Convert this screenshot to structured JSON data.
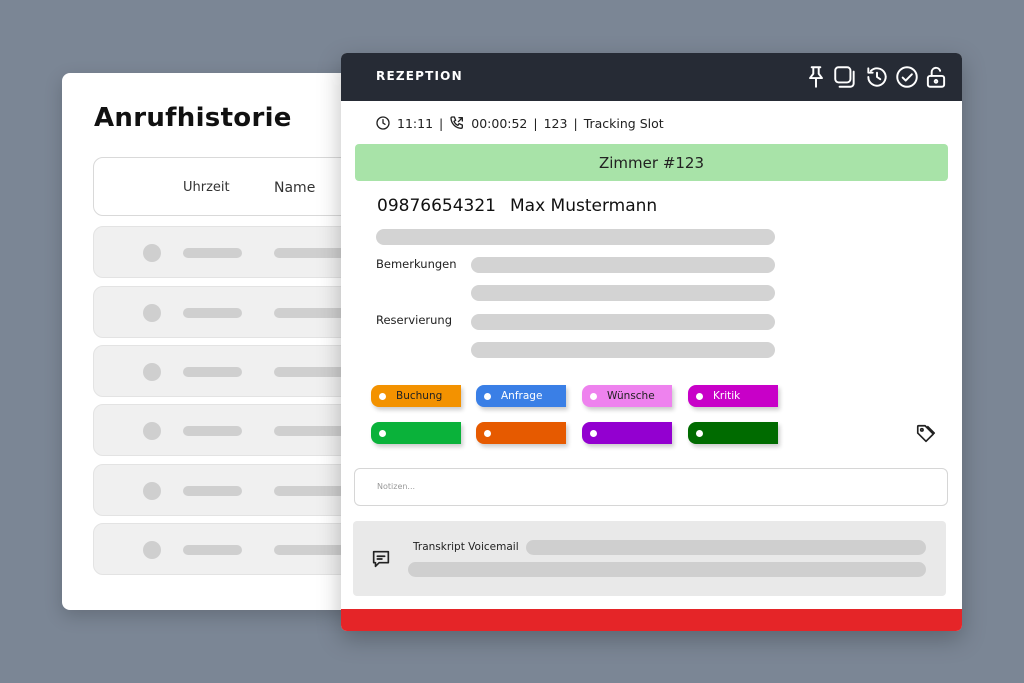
{
  "history": {
    "title": "Anrufhistorie",
    "columns": {
      "time": "Uhrzeit",
      "name": "Name"
    },
    "row_count": 6
  },
  "reception": {
    "title": "REZEPTION",
    "toolbar_icons": [
      "pin-icon",
      "copy-icon",
      "history-icon",
      "check-circle-icon",
      "unlock-icon"
    ],
    "info": {
      "time": "11:11",
      "duration": "00:00:52",
      "extension": "123",
      "slot": "Tracking Slot"
    },
    "room": "Zimmer #123",
    "caller": {
      "phone": "09876654321",
      "name": "Max Mustermann"
    },
    "labels": {
      "remarks": "Bemerkungen",
      "reservation": "Reservierung"
    },
    "tags_labeled": [
      {
        "label": "Buchung",
        "color": "#f39200"
      },
      {
        "label": "Anfrage",
        "color": "#3a7fe6"
      },
      {
        "label": "Wünsche",
        "color": "#ee82ee"
      },
      {
        "label": "Kritik",
        "color": "#c800c8"
      }
    ],
    "tags_unlabeled": [
      {
        "color": "#0ab23a"
      },
      {
        "color": "#e65a00"
      },
      {
        "color": "#9300d0"
      },
      {
        "color": "#006b00"
      }
    ],
    "notes_placeholder": "Notizen...",
    "voicemail_label": "Transkript Voicemail",
    "status_color": "#e52528",
    "room_color": "#a8e3a8"
  }
}
